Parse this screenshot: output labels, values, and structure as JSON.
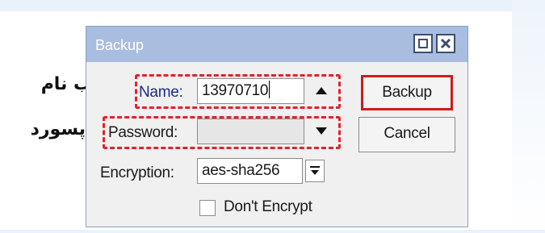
{
  "annotations": {
    "name_hint": "انتخاب نام",
    "password_hint": "پسورد"
  },
  "dialog": {
    "title": "Backup",
    "titlebar_buttons": [
      "maximize-icon",
      "close-icon"
    ],
    "fields": {
      "name_label": "Name:",
      "name_value": "13970710",
      "password_label": "Password:",
      "password_value": "",
      "encryption_label": "Encryption:",
      "encryption_value": "aes-sha256"
    },
    "checkbox": {
      "label": "Don't Encrypt",
      "checked": false
    },
    "buttons": {
      "backup": "Backup",
      "cancel": "Cancel"
    }
  },
  "colors": {
    "titlebar": "#a9bde0",
    "annotation_red": "#e2222b",
    "name_label_blue": "#1f2a8c"
  }
}
